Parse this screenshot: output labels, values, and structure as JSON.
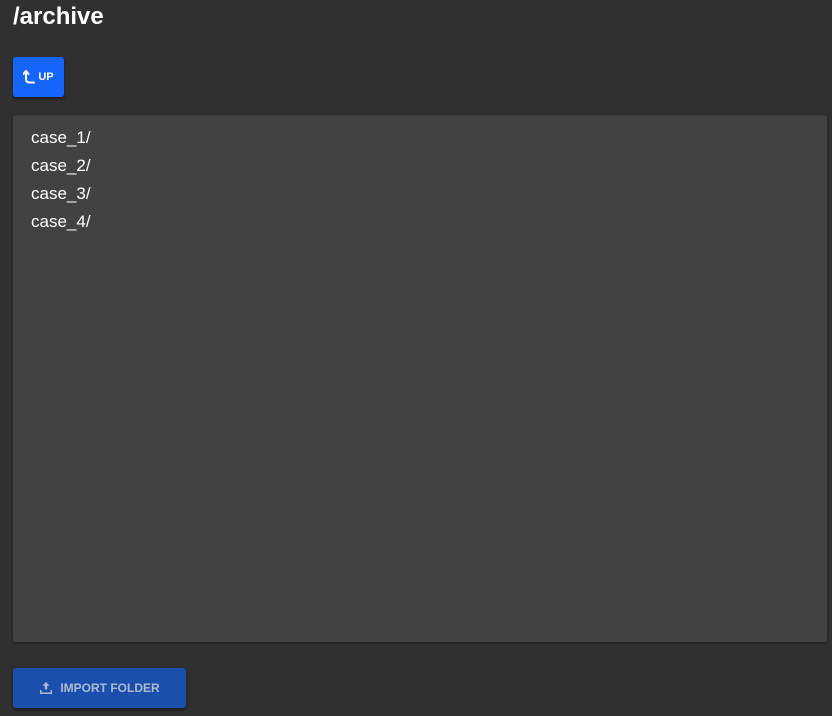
{
  "header": {
    "path": "/archive"
  },
  "toolbar": {
    "up_label": "UP",
    "up_icon": "level-up-arrow-icon"
  },
  "folder_list": {
    "items": [
      {
        "label": "case_1/"
      },
      {
        "label": "case_2/"
      },
      {
        "label": "case_3/"
      },
      {
        "label": "case_4/"
      }
    ]
  },
  "footer": {
    "import_label": "IMPORT FOLDER",
    "import_icon": "upload-icon"
  },
  "colors": {
    "background": "#303030",
    "panel": "#424242",
    "primary": "#1565fb",
    "primary_disabled": "#1a4fae"
  }
}
